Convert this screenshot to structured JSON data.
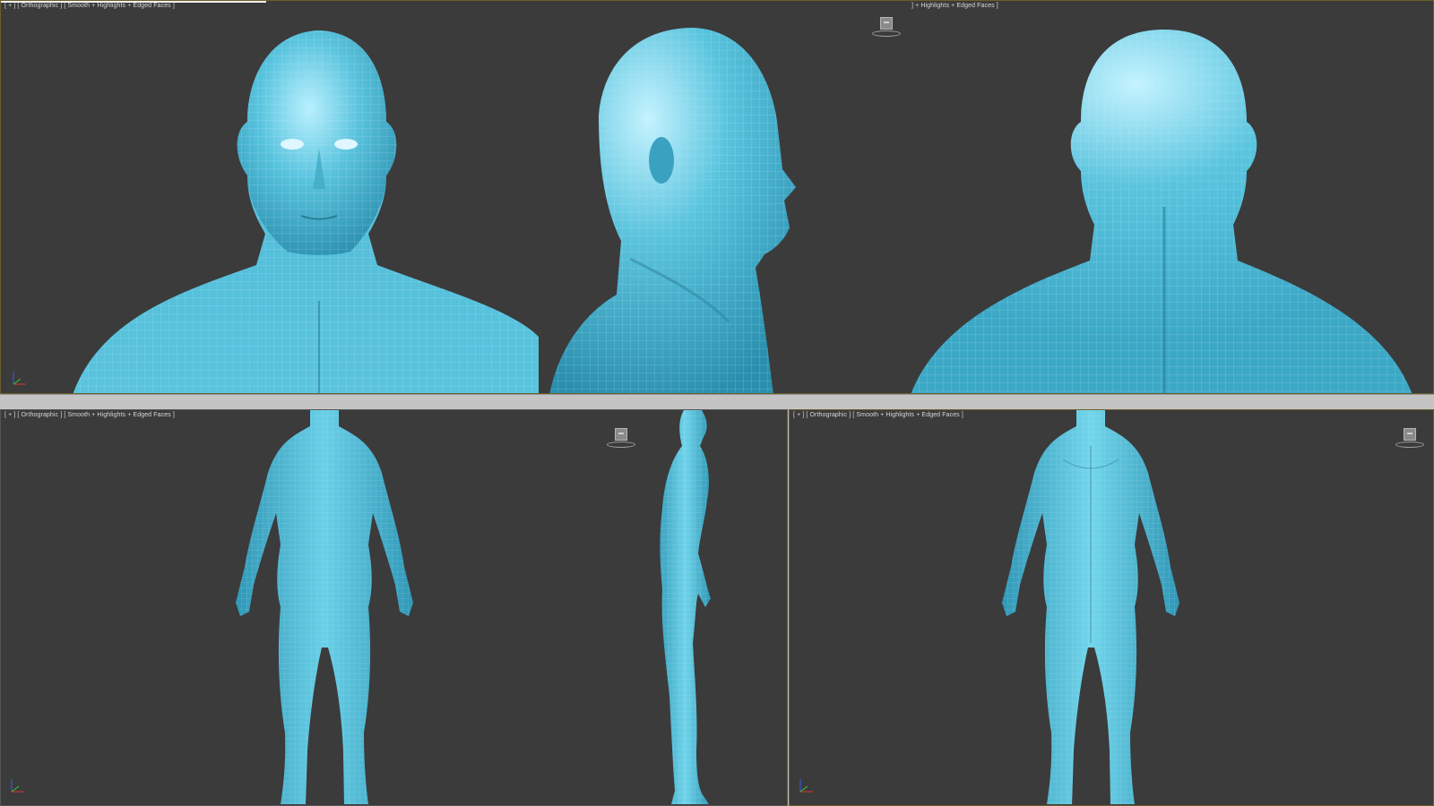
{
  "viewports": {
    "top": {
      "label_left_bracket": "[ + ]",
      "label_left_view": "[ Orthographic ]",
      "label_left_shading": "[ Smooth + Highlights + Edged Faces ]",
      "label_right": "] + Highlights + Edged Faces ]"
    },
    "bottom_left": {
      "label_bracket": "[ + ]",
      "label_view": "[ Orthographic ]",
      "label_shading": "[ Smooth + Highlights + Edged Faces ]"
    },
    "bottom_right": {
      "label_bracket": "[ + ]",
      "label_view": "[ Orthographic ]",
      "label_shading": "[ Smooth + Highlights + Edged Faces ]"
    }
  },
  "icons": {
    "viewcube": "viewcube-icon",
    "axis": "axis-tripod-icon"
  },
  "colors": {
    "model": "#5ac4de",
    "model_shadow": "#2a8fae",
    "model_highlight": "#b8f0ff",
    "wire": "#cfeff7",
    "viewport_bg": "#3b3b3b",
    "active_border": "#6a5e2c"
  }
}
